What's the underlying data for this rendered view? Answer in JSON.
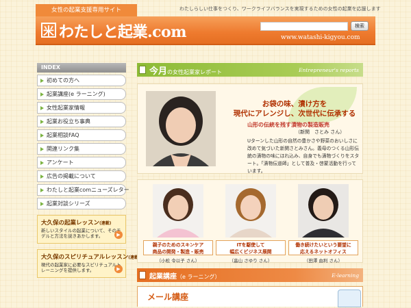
{
  "header": {
    "tagline_tab": "女性の起業支援専用サイト",
    "tagline": "わたしらしい仕事をつくり、ワークライフバランスを実現するための女性の起業を応援します",
    "logo_mark": "米",
    "logo_text": "わたしと起業.com",
    "search_button": "検索",
    "url": "www.watashi-kigyou.com"
  },
  "sidebar": {
    "index_label": "INDEX",
    "items": [
      {
        "label": "初めての方へ"
      },
      {
        "label": "起業講座(e ラーニング)"
      },
      {
        "label": "女性起業家情報"
      },
      {
        "label": "起業お役立ち事典"
      },
      {
        "label": "起業相談FAQ"
      },
      {
        "label": "関連リンク集"
      },
      {
        "label": "アンケート"
      },
      {
        "label": "広告の掲載について"
      },
      {
        "label": "わたしと起業comニューズレター"
      },
      {
        "label": "起業対談シリーズ"
      }
    ],
    "promos": [
      {
        "title": "大久保の起業レッスン",
        "badge": "(連載)",
        "desc": "新しいスタイルの起業について、そのモデルと方法を説きあかします。"
      },
      {
        "title": "大久保のスピリチュアルレッスン",
        "badge": "(連載)",
        "desc": "現代の起業家に必要なスピリチュアルトレーニングを提供します。"
      }
    ]
  },
  "report": {
    "title_main": "今月",
    "title_rest": "の女性起業家レポート",
    "title_en": "Entrepreneur's reports",
    "headline_1": "お袋の味、漬け方を",
    "headline_2": "現代にアレンジし、次世代に伝承する",
    "subtitle": "山形の伝統を残す漬物の製造販売",
    "name": "（新関　さとみ さん）",
    "desc": "Uターンした山形の自然の豊かさや野菜のおいしさに改めて気づいた新関さとみさん。義母のつくる山形伝統の漬物の味にほれ込み、自身でも漬物づくりをスタート。「漬物伝道師」として普及・啓蒙活動を行っています。"
  },
  "people": [
    {
      "caption_1": "親子のためのスキンケア",
      "caption_2": "商品の開発・製造・販売",
      "name": "（小松 令以子 さん）"
    },
    {
      "caption_1": "ITを駆使して",
      "caption_2": "幅広くビジネス展開",
      "name": "（畠山 さゆり さん）"
    },
    {
      "caption_1": "働き続けたいという要望に",
      "caption_2": "応えるネットオフィス",
      "name": "（田澤 由利 さん）"
    }
  ],
  "elearning": {
    "title": "起業講座",
    "title_small": "（e ラーニング）",
    "title_en": "E-learning",
    "mail_title": "メール講座"
  },
  "colors": {
    "accent_orange": "#ee7a2e",
    "accent_green": "#8dbb36"
  }
}
